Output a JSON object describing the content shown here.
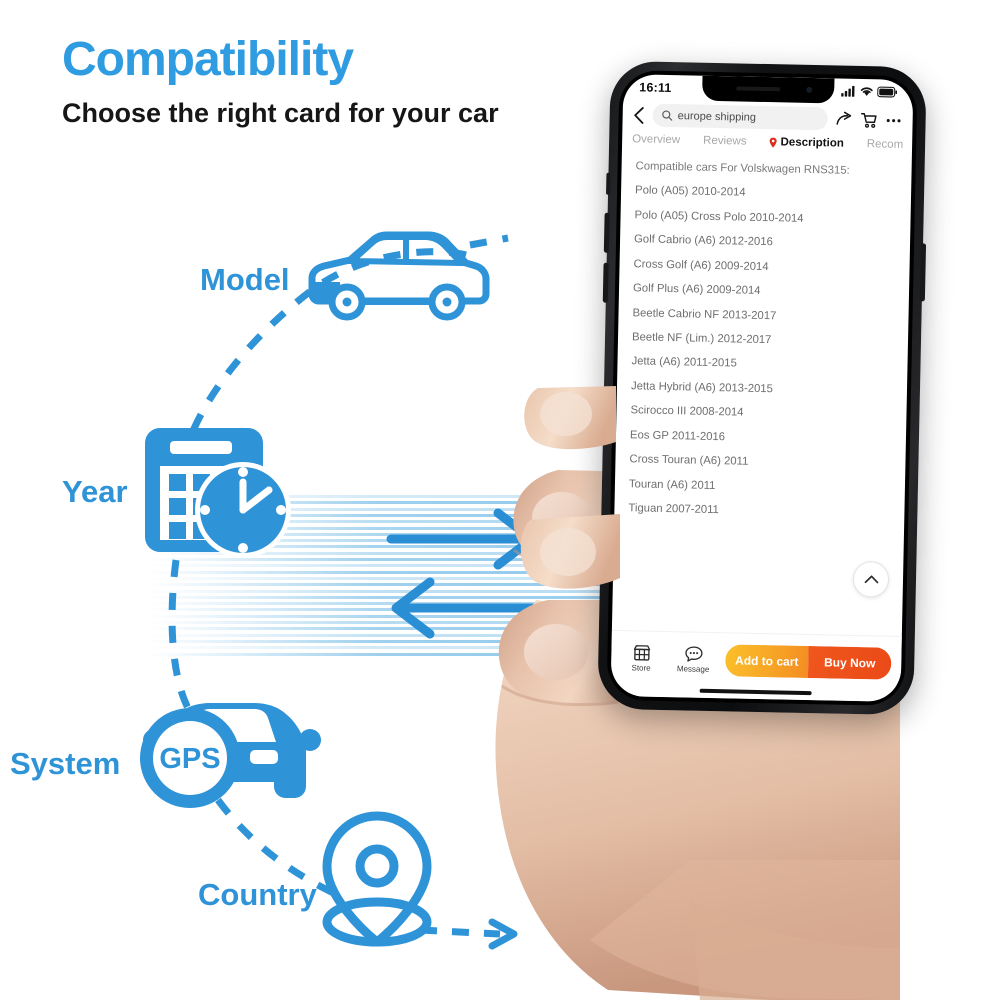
{
  "heading": {
    "title": "Compatibility",
    "subtitle": "Choose the right card for your car",
    "title_color": "#2f9be0",
    "subtitle_color": "#161616"
  },
  "diagram": {
    "accent_color": "#2f93d8",
    "nodes": [
      {
        "label": "Model",
        "icon": "car-side-icon"
      },
      {
        "label": "Year",
        "icon": "calendar-clock-icon"
      },
      {
        "label": "System",
        "icon": "car-gps-icon"
      },
      {
        "label": "Country",
        "icon": "map-pin-icon"
      }
    ],
    "gps_badge": "GPS",
    "arrows": [
      {
        "name": "arrow-right",
        "direction": "right"
      },
      {
        "name": "arrow-left",
        "direction": "left"
      }
    ]
  },
  "phone": {
    "status_bar": {
      "time": "16:11",
      "icons": [
        "signal-icon",
        "wifi-icon",
        "battery-icon"
      ]
    },
    "nav": {
      "back_icon": "back-chevron-icon",
      "search_placeholder": "europe shipping",
      "search_value": "europe shipping",
      "search_icon": "search-icon",
      "share_icon": "share-icon",
      "cart_icon": "cart-icon",
      "more_icon": "more-dots-icon"
    },
    "tabs": [
      {
        "label": "Overview",
        "active": false
      },
      {
        "label": "Reviews",
        "active": false
      },
      {
        "label": "Description",
        "active": true,
        "icon": "pin-icon"
      },
      {
        "label": "Recom",
        "active": false,
        "clipped": true
      }
    ],
    "description": {
      "header": "Compatible cars For Volskwagen RNS315:",
      "rows": [
        "Polo (A05) 2010-2014",
        "Polo (A05) Cross Polo 2010-2014",
        "Golf Cabrio (A6) 2012-2016",
        "Cross Golf (A6) 2009-2014",
        "Golf Plus (A6) 2009-2014",
        "Beetle Cabrio NF 2013-2017",
        "Beetle NF (Lim.) 2012-2017",
        "Jetta (A6) 2011-2015",
        "Jetta Hybrid (A6) 2013-2015",
        "Scirocco III 2008-2014",
        "Eos GP 2011-2016",
        "Cross Touran (A6) 2011",
        "Touran (A6) 2011",
        "Tiguan 2007-2011"
      ]
    },
    "scroll_top_icon": "chevron-up-icon",
    "action_bar": {
      "store_label": "Store",
      "store_icon": "store-icon",
      "message_label": "Message",
      "message_icon": "message-icon",
      "add_to_cart_label": "Add to cart",
      "buy_now_label": "Buy Now",
      "add_to_cart_color": "#f7a526",
      "buy_now_color": "#ea4a17"
    }
  }
}
